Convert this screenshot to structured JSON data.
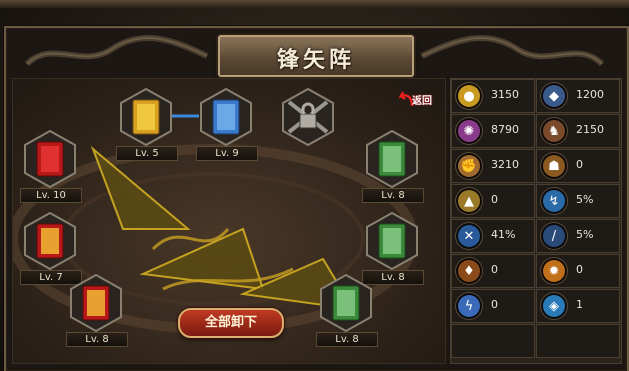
{
  "title": "锋矢阵",
  "back_label": "返回",
  "unload_all_label": "全部卸下",
  "slots": [
    {
      "id": "s1",
      "level": "Lv. 5",
      "color": "gold"
    },
    {
      "id": "s2",
      "level": "Lv. 9",
      "color": "blue"
    },
    {
      "id": "s3",
      "level": "",
      "color": "locked"
    },
    {
      "id": "s4",
      "level": "Lv. 10",
      "color": "red"
    },
    {
      "id": "s5",
      "level": "Lv. 8",
      "color": "green"
    },
    {
      "id": "s6",
      "level": "Lv. 7",
      "color": "red"
    },
    {
      "id": "s7",
      "level": "Lv. 8",
      "color": "green"
    },
    {
      "id": "s8",
      "level": "Lv. 8",
      "color": "red"
    },
    {
      "id": "s9",
      "level": "Lv. 8",
      "color": "green"
    }
  ],
  "stats": [
    {
      "icon": "gold-orb-icon",
      "value": "3150",
      "color": "#c89a20"
    },
    {
      "icon": "shield-icon",
      "value": "1200",
      "color": "#3a5a8a"
    },
    {
      "icon": "purple-orb-icon",
      "value": "8790",
      "color": "#8a3a8a"
    },
    {
      "icon": "warrior-icon",
      "value": "2150",
      "color": "#7a4a2a"
    },
    {
      "icon": "fist-icon",
      "value": "3210",
      "color": "#a06a30"
    },
    {
      "icon": "helmet-icon",
      "value": "0",
      "color": "#8a5a20"
    },
    {
      "icon": "arrow-up-icon",
      "value": "0",
      "color": "#9a7a28"
    },
    {
      "icon": "blue-swirl-icon",
      "value": "5%",
      "color": "#2a6aa8"
    },
    {
      "icon": "crossed-swords-icon",
      "value": "41%",
      "color": "#2a5a9a"
    },
    {
      "icon": "slash-icon",
      "value": "5%",
      "color": "#2a4a7a"
    },
    {
      "icon": "beast-icon",
      "value": "0",
      "color": "#8a4a1a"
    },
    {
      "icon": "fire-burst-icon",
      "value": "0",
      "color": "#c0701a"
    },
    {
      "icon": "lightning-icon",
      "value": "0",
      "color": "#3a6ab8"
    },
    {
      "icon": "gem-icon",
      "value": "1",
      "color": "#2a7ab8"
    },
    {
      "icon": "",
      "value": "",
      "color": ""
    },
    {
      "icon": "",
      "value": "",
      "color": ""
    }
  ]
}
